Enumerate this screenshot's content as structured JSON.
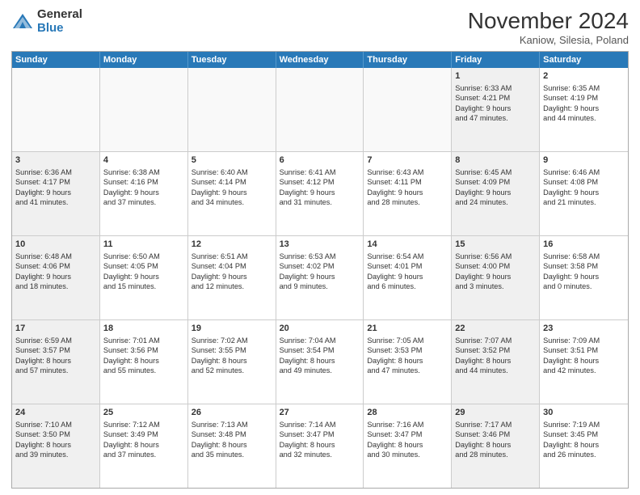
{
  "logo": {
    "general": "General",
    "blue": "Blue"
  },
  "header": {
    "month": "November 2024",
    "location": "Kaniow, Silesia, Poland"
  },
  "days": [
    "Sunday",
    "Monday",
    "Tuesday",
    "Wednesday",
    "Thursday",
    "Friday",
    "Saturday"
  ],
  "rows": [
    [
      {
        "num": "",
        "info": "",
        "empty": true
      },
      {
        "num": "",
        "info": "",
        "empty": true
      },
      {
        "num": "",
        "info": "",
        "empty": true
      },
      {
        "num": "",
        "info": "",
        "empty": true
      },
      {
        "num": "",
        "info": "",
        "empty": true
      },
      {
        "num": "1",
        "info": "Sunrise: 6:33 AM\nSunset: 4:21 PM\nDaylight: 9 hours\nand 47 minutes.",
        "shaded": true
      },
      {
        "num": "2",
        "info": "Sunrise: 6:35 AM\nSunset: 4:19 PM\nDaylight: 9 hours\nand 44 minutes.",
        "shaded": false
      }
    ],
    [
      {
        "num": "3",
        "info": "Sunrise: 6:36 AM\nSunset: 4:17 PM\nDaylight: 9 hours\nand 41 minutes.",
        "shaded": true
      },
      {
        "num": "4",
        "info": "Sunrise: 6:38 AM\nSunset: 4:16 PM\nDaylight: 9 hours\nand 37 minutes.",
        "shaded": false
      },
      {
        "num": "5",
        "info": "Sunrise: 6:40 AM\nSunset: 4:14 PM\nDaylight: 9 hours\nand 34 minutes.",
        "shaded": false
      },
      {
        "num": "6",
        "info": "Sunrise: 6:41 AM\nSunset: 4:12 PM\nDaylight: 9 hours\nand 31 minutes.",
        "shaded": false
      },
      {
        "num": "7",
        "info": "Sunrise: 6:43 AM\nSunset: 4:11 PM\nDaylight: 9 hours\nand 28 minutes.",
        "shaded": false
      },
      {
        "num": "8",
        "info": "Sunrise: 6:45 AM\nSunset: 4:09 PM\nDaylight: 9 hours\nand 24 minutes.",
        "shaded": true
      },
      {
        "num": "9",
        "info": "Sunrise: 6:46 AM\nSunset: 4:08 PM\nDaylight: 9 hours\nand 21 minutes.",
        "shaded": false
      }
    ],
    [
      {
        "num": "10",
        "info": "Sunrise: 6:48 AM\nSunset: 4:06 PM\nDaylight: 9 hours\nand 18 minutes.",
        "shaded": true
      },
      {
        "num": "11",
        "info": "Sunrise: 6:50 AM\nSunset: 4:05 PM\nDaylight: 9 hours\nand 15 minutes.",
        "shaded": false
      },
      {
        "num": "12",
        "info": "Sunrise: 6:51 AM\nSunset: 4:04 PM\nDaylight: 9 hours\nand 12 minutes.",
        "shaded": false
      },
      {
        "num": "13",
        "info": "Sunrise: 6:53 AM\nSunset: 4:02 PM\nDaylight: 9 hours\nand 9 minutes.",
        "shaded": false
      },
      {
        "num": "14",
        "info": "Sunrise: 6:54 AM\nSunset: 4:01 PM\nDaylight: 9 hours\nand 6 minutes.",
        "shaded": false
      },
      {
        "num": "15",
        "info": "Sunrise: 6:56 AM\nSunset: 4:00 PM\nDaylight: 9 hours\nand 3 minutes.",
        "shaded": true
      },
      {
        "num": "16",
        "info": "Sunrise: 6:58 AM\nSunset: 3:58 PM\nDaylight: 9 hours\nand 0 minutes.",
        "shaded": false
      }
    ],
    [
      {
        "num": "17",
        "info": "Sunrise: 6:59 AM\nSunset: 3:57 PM\nDaylight: 8 hours\nand 57 minutes.",
        "shaded": true
      },
      {
        "num": "18",
        "info": "Sunrise: 7:01 AM\nSunset: 3:56 PM\nDaylight: 8 hours\nand 55 minutes.",
        "shaded": false
      },
      {
        "num": "19",
        "info": "Sunrise: 7:02 AM\nSunset: 3:55 PM\nDaylight: 8 hours\nand 52 minutes.",
        "shaded": false
      },
      {
        "num": "20",
        "info": "Sunrise: 7:04 AM\nSunset: 3:54 PM\nDaylight: 8 hours\nand 49 minutes.",
        "shaded": false
      },
      {
        "num": "21",
        "info": "Sunrise: 7:05 AM\nSunset: 3:53 PM\nDaylight: 8 hours\nand 47 minutes.",
        "shaded": false
      },
      {
        "num": "22",
        "info": "Sunrise: 7:07 AM\nSunset: 3:52 PM\nDaylight: 8 hours\nand 44 minutes.",
        "shaded": true
      },
      {
        "num": "23",
        "info": "Sunrise: 7:09 AM\nSunset: 3:51 PM\nDaylight: 8 hours\nand 42 minutes.",
        "shaded": false
      }
    ],
    [
      {
        "num": "24",
        "info": "Sunrise: 7:10 AM\nSunset: 3:50 PM\nDaylight: 8 hours\nand 39 minutes.",
        "shaded": true
      },
      {
        "num": "25",
        "info": "Sunrise: 7:12 AM\nSunset: 3:49 PM\nDaylight: 8 hours\nand 37 minutes.",
        "shaded": false
      },
      {
        "num": "26",
        "info": "Sunrise: 7:13 AM\nSunset: 3:48 PM\nDaylight: 8 hours\nand 35 minutes.",
        "shaded": false
      },
      {
        "num": "27",
        "info": "Sunrise: 7:14 AM\nSunset: 3:47 PM\nDaylight: 8 hours\nand 32 minutes.",
        "shaded": false
      },
      {
        "num": "28",
        "info": "Sunrise: 7:16 AM\nSunset: 3:47 PM\nDaylight: 8 hours\nand 30 minutes.",
        "shaded": false
      },
      {
        "num": "29",
        "info": "Sunrise: 7:17 AM\nSunset: 3:46 PM\nDaylight: 8 hours\nand 28 minutes.",
        "shaded": true
      },
      {
        "num": "30",
        "info": "Sunrise: 7:19 AM\nSunset: 3:45 PM\nDaylight: 8 hours\nand 26 minutes.",
        "shaded": false
      }
    ]
  ]
}
